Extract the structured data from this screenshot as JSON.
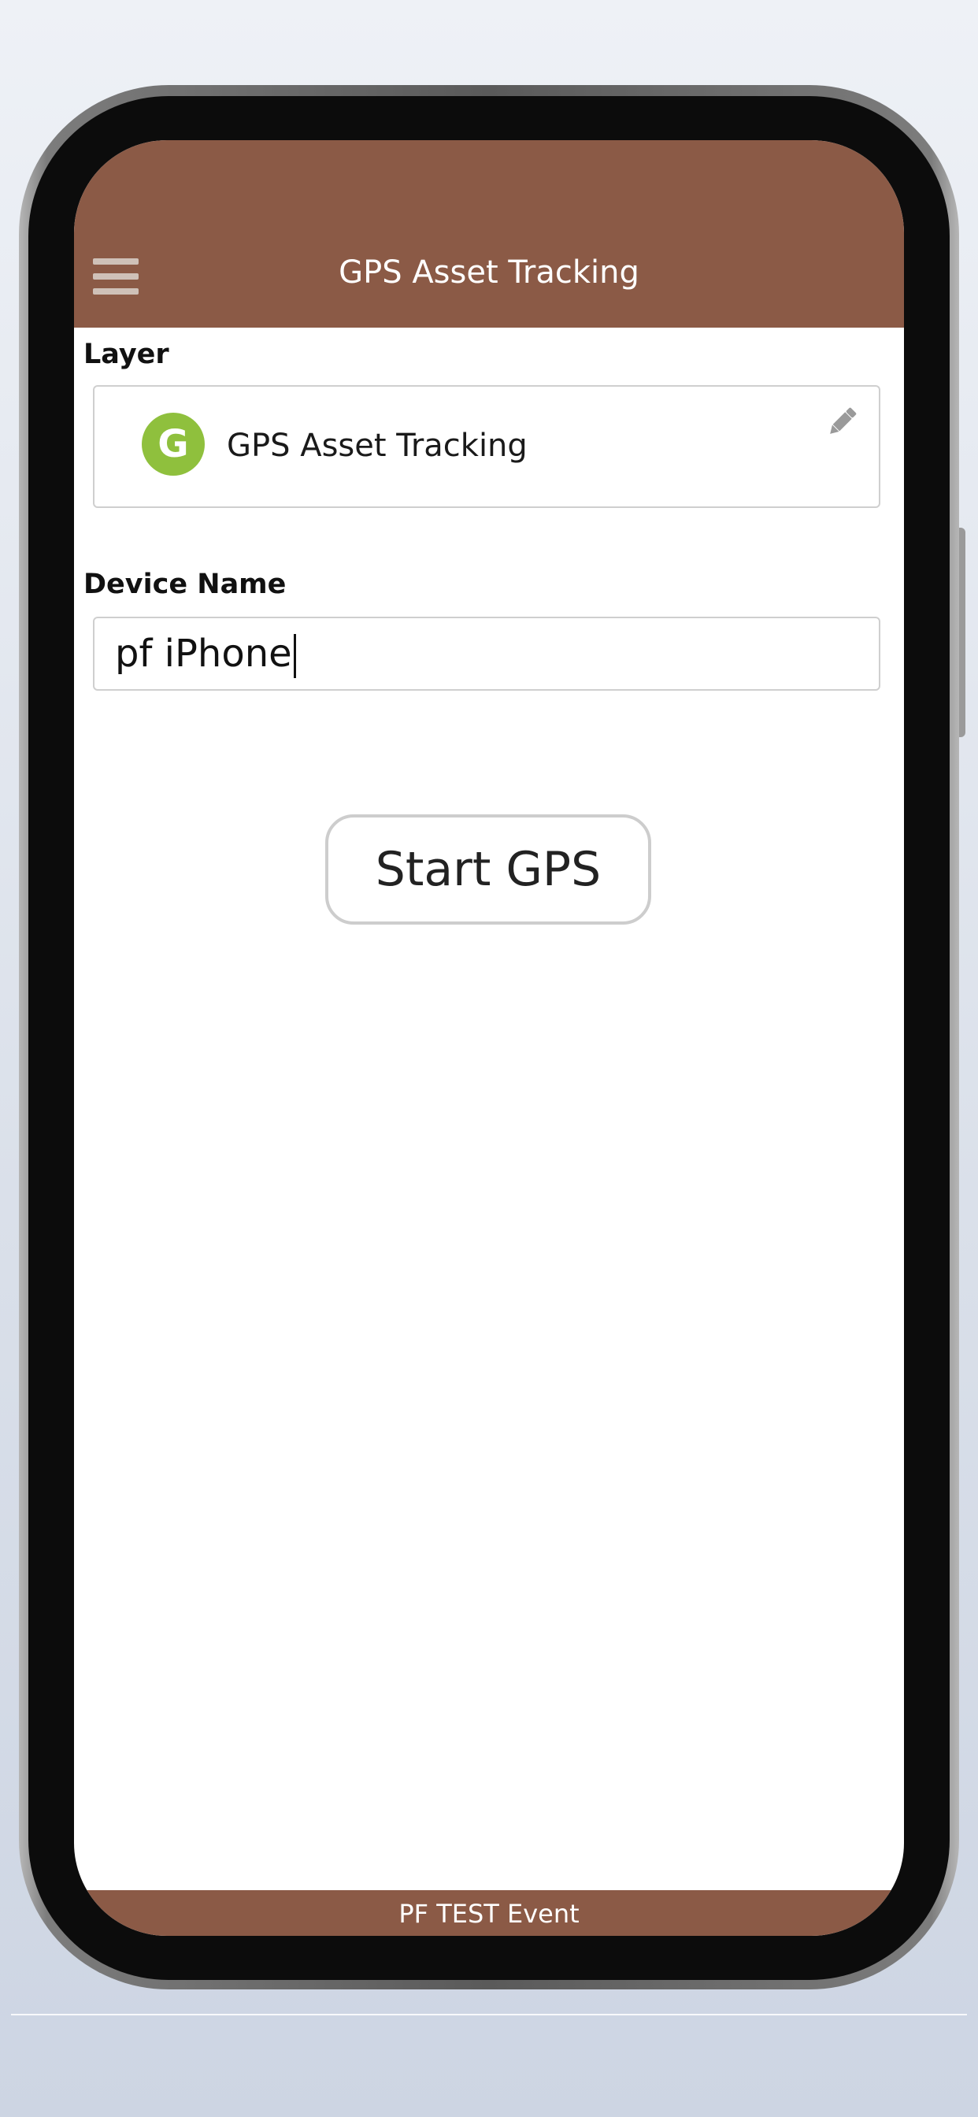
{
  "header": {
    "title": "GPS Asset Tracking",
    "menu_icon": "hamburger-menu-icon"
  },
  "layer": {
    "label": "Layer",
    "badge_letter": "G",
    "name": "GPS Asset Tracking",
    "edit_icon": "pencil-icon"
  },
  "device": {
    "label": "Device Name",
    "value": "pf iPhone"
  },
  "actions": {
    "start_label": "Start GPS"
  },
  "footer": {
    "text": "PF TEST Event"
  },
  "colors": {
    "brand": "#8b5a46",
    "badge": "#8fc03d",
    "menu_icon": "#cfc1b8"
  }
}
